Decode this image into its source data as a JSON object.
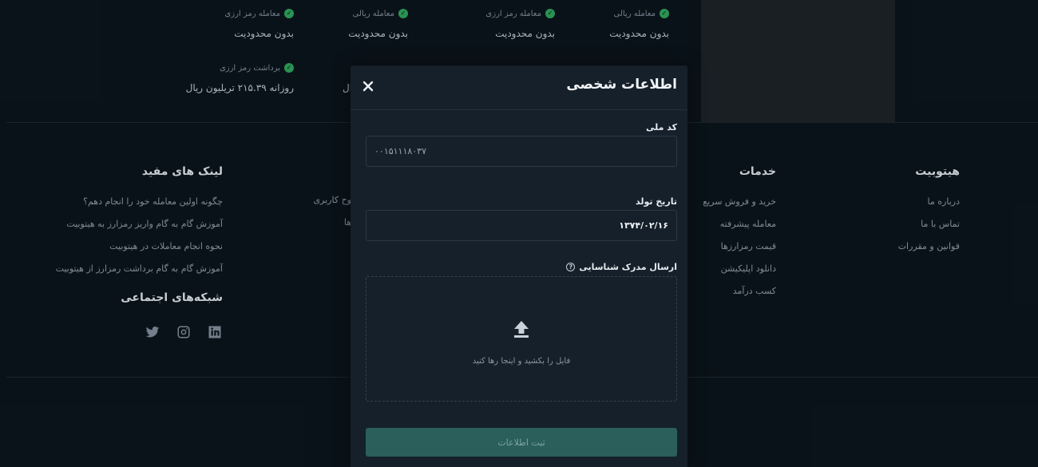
{
  "limits": {
    "row1": [
      {
        "label": "معامله ریالی",
        "value": "بدون محدودیت"
      },
      {
        "label": "معامله رمز ارزی",
        "value": "بدون محدودیت"
      },
      {
        "label": "معامله ریالی",
        "value": "بدون محدودیت"
      },
      {
        "label": "معامله رمز ارزی",
        "value": "بدون محدودیت"
      }
    ],
    "row2": [
      {
        "label": "برداشت رمز ارزی",
        "value": "روزانه ۲۱۵.۳۹ تریلیون ریال"
      }
    ],
    "partial_value": "ال"
  },
  "footer": {
    "hitobit": {
      "title": "هیتوبیت",
      "links": [
        "درباره ما",
        "تماس با ما",
        "قوانین و مقررات"
      ]
    },
    "services": {
      "title": "خدمات",
      "links": [
        "خرید و فروش سریع",
        "معامله پیشرفته",
        "قیمت رمزارزها",
        "دانلود اپلیکیشن",
        "کسب درآمد"
      ]
    },
    "partial": {
      "links": [
        "وح کاربری",
        "ها"
      ]
    },
    "useful_links": {
      "title": "لینک های مفید",
      "links": [
        "چگونه اولین معامله خود را انجام دهم؟",
        "آموزش گام به گام واریز رمزارز به هیتوبیت",
        "نحوه انجام معاملات در هیتوبیت",
        "آموزش گام به گام برداشت رمزارز از هیتوبیت"
      ]
    },
    "social": {
      "title": "شبکه‌های اجتماعی",
      "icons": [
        "linkedin-icon",
        "instagram-icon",
        "twitter-icon"
      ]
    }
  },
  "modal": {
    "title": "اطلاعات شخصی",
    "national_code": {
      "label": "کد ملی",
      "value": "۰۰۱۵۱۱۱۸۰۳۷"
    },
    "birth_date": {
      "label": "تاریخ تولد",
      "value": "۱۳۷۴/۰۲/۱۶"
    },
    "id_upload": {
      "label": "ارسال مدرک شناسایی",
      "hint": "فایل را بکشید و اینجا رها کنید"
    },
    "submit_label": "ثبت اطلاعات"
  },
  "colors": {
    "background": "#0b141c",
    "modal": "#15202b",
    "check_green": "#2ea05a",
    "submit_button": "#2a5f5c"
  }
}
